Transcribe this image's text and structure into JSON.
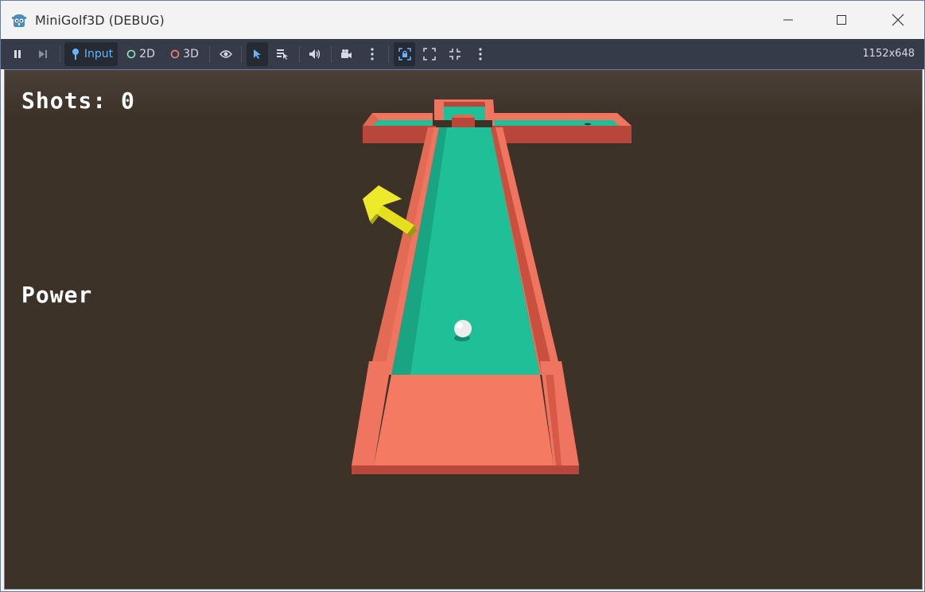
{
  "window": {
    "title": "MiniGolf3D (DEBUG)"
  },
  "toolbar": {
    "input_label": "Input",
    "mode_2d_label": "2D",
    "mode_3d_label": "3D",
    "resolution": "1152x648"
  },
  "hud": {
    "shots": "Shots: 0",
    "power": "Power"
  },
  "colors": {
    "background": "#3d3228",
    "green": "#1fbf97",
    "wall": "#f07560",
    "wall_dark": "#b8463a",
    "tee": "#f47a62",
    "arrow": "#e4e01e",
    "ball": "#ececec"
  }
}
